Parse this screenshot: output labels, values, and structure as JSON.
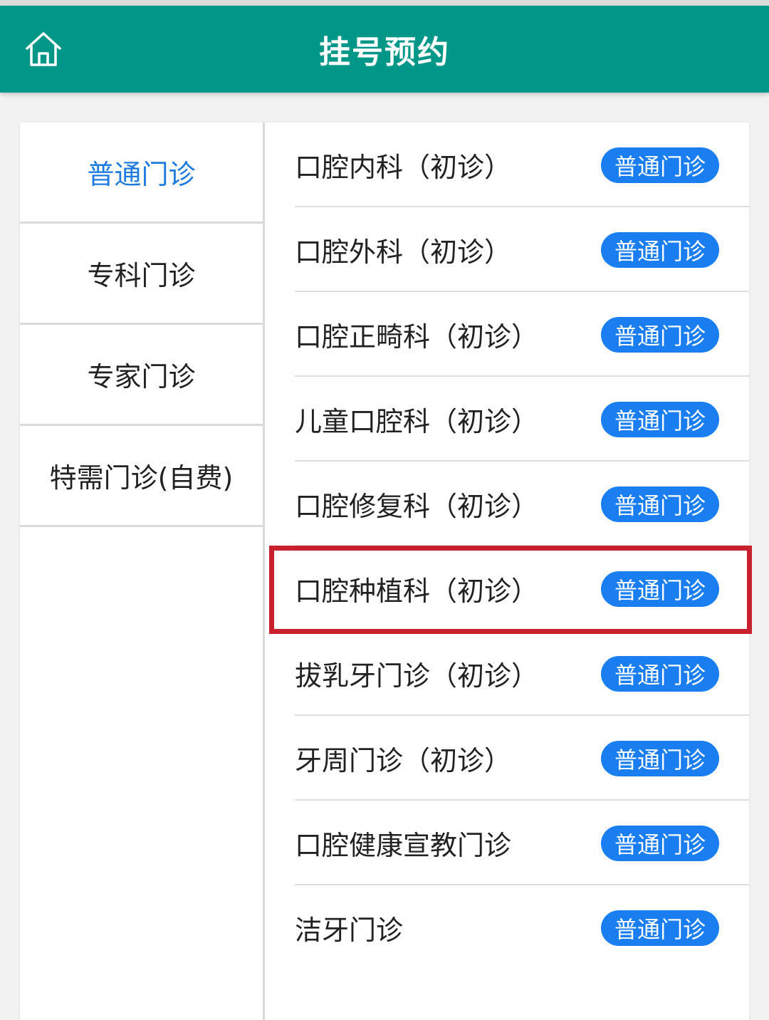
{
  "header": {
    "title": "挂号预约",
    "home_icon": "home-icon"
  },
  "colors": {
    "header_bg": "#009688",
    "active_menu": "#1e7be0",
    "badge_bg": "#1a7ef0",
    "highlight_border": "#c9202e"
  },
  "left_menu": {
    "items": [
      {
        "label": "普通门诊",
        "active": true
      },
      {
        "label": "专科门诊",
        "active": false
      },
      {
        "label": "专家门诊",
        "active": false
      },
      {
        "label": "特需门诊(自费)",
        "active": false
      }
    ]
  },
  "departments": [
    {
      "name": "口腔内科（初诊）",
      "badge": "普通门诊"
    },
    {
      "name": "口腔外科（初诊）",
      "badge": "普通门诊"
    },
    {
      "name": "口腔正畸科（初诊）",
      "badge": "普通门诊"
    },
    {
      "name": "儿童口腔科（初诊）",
      "badge": "普通门诊"
    },
    {
      "name": "口腔修复科（初诊）",
      "badge": "普通门诊"
    },
    {
      "name": "口腔种植科（初诊）",
      "badge": "普通门诊",
      "highlighted": true
    },
    {
      "name": "拔乳牙门诊（初诊）",
      "badge": "普通门诊"
    },
    {
      "name": "牙周门诊（初诊）",
      "badge": "普通门诊"
    },
    {
      "name": "口腔健康宣教门诊",
      "badge": "普通门诊"
    },
    {
      "name": "洁牙门诊",
      "badge": "普通门诊"
    }
  ]
}
